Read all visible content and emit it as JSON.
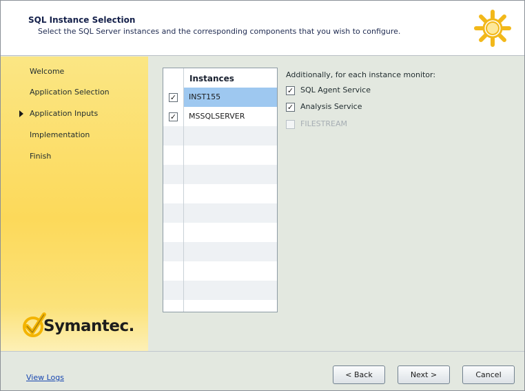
{
  "header": {
    "title": "SQL Instance Selection",
    "subtitle": "Select the SQL Server instances and the corresponding components that you wish to configure."
  },
  "sidebar": {
    "items": [
      {
        "label": "Welcome",
        "current": false
      },
      {
        "label": "Application Selection",
        "current": false
      },
      {
        "label": "Application Inputs",
        "current": true
      },
      {
        "label": "Implementation",
        "current": false
      },
      {
        "label": "Finish",
        "current": false
      }
    ],
    "logo_text": "Symantec."
  },
  "instances": {
    "column_header": "Instances",
    "rows": [
      {
        "name": "INST155",
        "checked": true,
        "selected": true
      },
      {
        "name": "MSSQLSERVER",
        "checked": true,
        "selected": false
      }
    ]
  },
  "monitor": {
    "title": "Additionally, for each instance monitor:",
    "options": [
      {
        "label": "SQL Agent Service",
        "checked": true,
        "enabled": true
      },
      {
        "label": "Analysis Service",
        "checked": true,
        "enabled": true
      },
      {
        "label": "FILESTREAM",
        "checked": false,
        "enabled": false
      }
    ]
  },
  "footer": {
    "view_logs": "View Logs",
    "back_label": "< Back",
    "next_label": "Next >",
    "cancel_label": "Cancel"
  },
  "colors": {
    "sidebar": "#fcd95a",
    "selected_row": "#9ec8f0",
    "link": "#1746b0",
    "check_mark": "#f3b400"
  },
  "icons": {
    "header": "gear-icon",
    "current_step": "arrow-right-icon",
    "checked": "check-mark-icon"
  }
}
